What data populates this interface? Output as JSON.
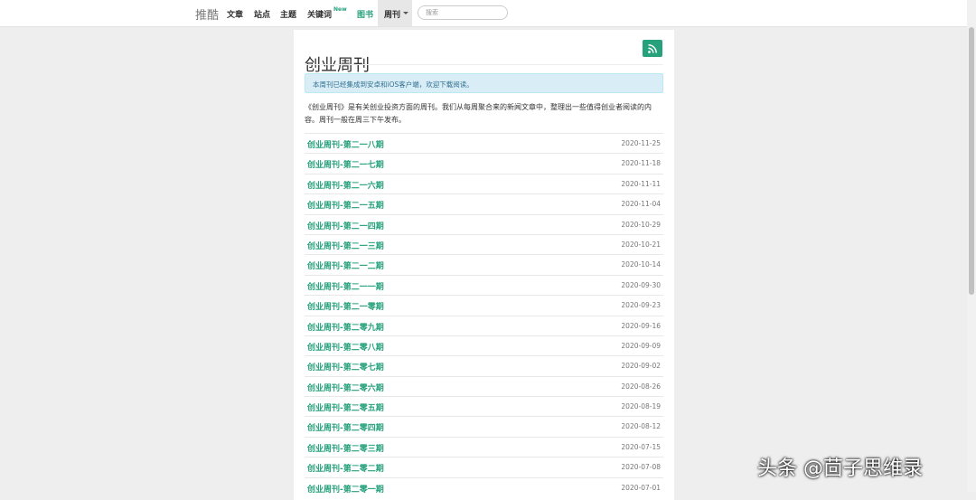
{
  "nav": {
    "brand": "推酷",
    "items": [
      "文章",
      "站点",
      "主题",
      "关键词",
      "图书"
    ],
    "new_badge": "New",
    "weekly": "周刊",
    "search_placeholder": "搜索"
  },
  "page": {
    "title": "创业周刊",
    "alert": "本周刊已经集成到安卓和iOS客户端，欢迎下载阅读。",
    "intro": "《创业周刊》是有关创业投资方面的周刊。我们从每周聚合来的新闻文章中，整理出一些值得创业者阅读的内容。周刊一般在周三下午发布。",
    "issues": [
      {
        "title": "创业周刊-第二一八期",
        "date": "2020-11-25"
      },
      {
        "title": "创业周刊-第二一七期",
        "date": "2020-11-18"
      },
      {
        "title": "创业周刊-第二一六期",
        "date": "2020-11-11"
      },
      {
        "title": "创业周刊-第二一五期",
        "date": "2020-11-04"
      },
      {
        "title": "创业周刊-第二一四期",
        "date": "2020-10-29"
      },
      {
        "title": "创业周刊-第二一三期",
        "date": "2020-10-21"
      },
      {
        "title": "创业周刊-第二一二期",
        "date": "2020-10-14"
      },
      {
        "title": "创业周刊-第二一一期",
        "date": "2020-09-30"
      },
      {
        "title": "创业周刊-第二一零期",
        "date": "2020-09-23"
      },
      {
        "title": "创业周刊-第二零九期",
        "date": "2020-09-16"
      },
      {
        "title": "创业周刊-第二零八期",
        "date": "2020-09-09"
      },
      {
        "title": "创业周刊-第二零七期",
        "date": "2020-09-02"
      },
      {
        "title": "创业周刊-第二零六期",
        "date": "2020-08-26"
      },
      {
        "title": "创业周刊-第二零五期",
        "date": "2020-08-19"
      },
      {
        "title": "创业周刊-第二零四期",
        "date": "2020-08-12"
      },
      {
        "title": "创业周刊-第二零三期",
        "date": "2020-07-15"
      },
      {
        "title": "创业周刊-第二零二期",
        "date": "2020-07-08"
      },
      {
        "title": "创业周刊-第二零一期",
        "date": "2020-07-01"
      }
    ]
  },
  "watermark": "头条 @茴子思维录",
  "colors": {
    "accent": "#27a17c",
    "alert_bg": "#d9edf7",
    "alert_text": "#31708f"
  }
}
